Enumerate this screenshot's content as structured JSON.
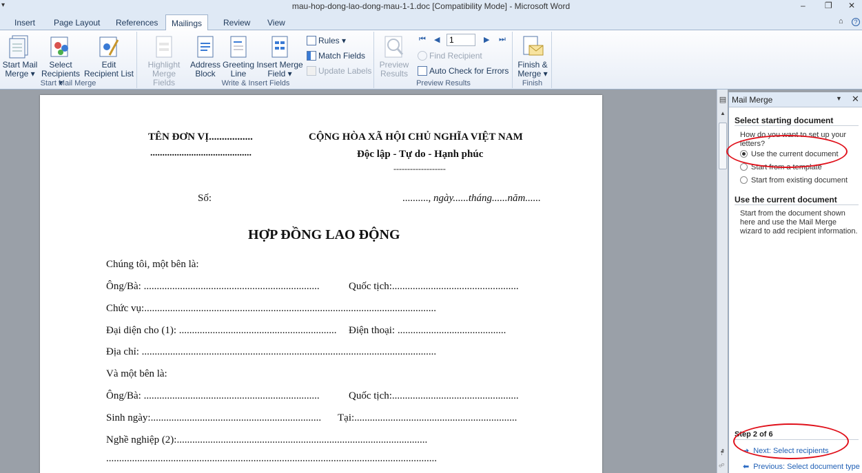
{
  "window": {
    "title": "mau-hop-dong-lao-dong-mau-1-1.doc [Compatibility Mode] - Microsoft Word",
    "qat_glyph": "▾",
    "minimize": "–",
    "restore": "❐",
    "close": "✕"
  },
  "tabs": [
    {
      "label": "Insert"
    },
    {
      "label": "Page Layout"
    },
    {
      "label": "References"
    },
    {
      "label": "Mailings"
    },
    {
      "label": "Review"
    },
    {
      "label": "View"
    }
  ],
  "tabs_right": {
    "collapse": "⌂",
    "help": "?"
  },
  "ribbon": {
    "start_mail_merge": {
      "label": "Start Mail Merge",
      "start_mail_merge_btn": "Start Mail",
      "start_mail_merge_btn2": "Merge ▾",
      "select_recipients": "Select",
      "select_recipients2": "Recipients ▾",
      "edit_recipient": "Edit",
      "edit_recipient2": "Recipient List"
    },
    "write_insert": {
      "label": "Write & Insert Fields",
      "highlight": "Highlight",
      "highlight2": "Merge Fields",
      "address": "Address",
      "address2": "Block",
      "greeting": "Greeting",
      "greeting2": "Line",
      "insert_merge": "Insert Merge",
      "insert_merge2": "Field ▾",
      "rules": "Rules ▾",
      "match_fields": "Match Fields",
      "update_labels": "Update Labels"
    },
    "preview": {
      "label": "Preview Results",
      "preview_btn": "Preview",
      "preview_btn2": "Results",
      "record_value": "1",
      "find_recipient": "Find Recipient",
      "auto_check": "Auto Check for Errors"
    },
    "finish": {
      "label": "Finish",
      "finish_btn": "Finish &",
      "finish_btn2": "Merge ▾"
    }
  },
  "document": {
    "org": "TÊN ĐƠN VỊ.................",
    "org_dots": "..........................................",
    "country": "CỘNG HÒA XÃ HỘI CHỦ NGHĨA VIỆT NAM",
    "motto": "Độc lập - Tự do - Hạnh phúc",
    "motto_line": "-------------------",
    "so": "Số:",
    "date_dots": "..........,",
    "date_text": "ngày......tháng......năm......",
    "heading": "HỢP ĐỒNG LAO ĐỘNG",
    "line1": "Chúng tôi, một bên là:",
    "line2a": "Ông/Bà:  ....................................................................",
    "line2b": "Quốc tịch:.................................................",
    "line3": "Chức vụ:.................................................................................................................",
    "line4a": "Đại diện cho (1):  .............................................................",
    "line4b": "Điện thoại:  ..........................................",
    "line5": "Địa chỉ:  ..................................................................................................................",
    "line6": "Và một bên là:",
    "line7a": "Ông/Bà:  ....................................................................",
    "line7b": "Quốc tịch:.................................................",
    "line8a": "Sinh ngày:..................................................................",
    "line8b": "Tại:...............................................................",
    "line9": "Nghề nghiệp (2):.................................................................................................",
    "line10": "................................................................................................................................"
  },
  "mail_merge_pane": {
    "title": "Mail Merge",
    "dropdown": "▼",
    "close": "✕",
    "section1": "Select starting document",
    "question": "How do you want to set up your letters?",
    "options": [
      {
        "label": "Use the current document"
      },
      {
        "label": "Start from a template"
      },
      {
        "label": "Start from existing document"
      }
    ],
    "section2": "Use the current document",
    "description": "Start from the document shown here and use the Mail Merge wizard to add recipient information.",
    "step": "Step 2 of 6",
    "next": "Next: Select recipients",
    "previous": "Previous: Select document type"
  },
  "annotation_color": "#e0101a"
}
